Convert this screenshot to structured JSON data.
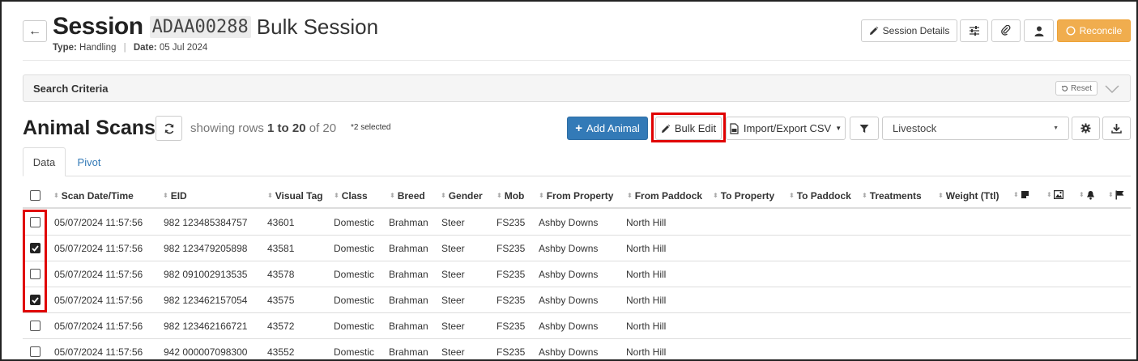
{
  "header": {
    "back_icon": "←",
    "title": "Session",
    "code": "ADAA00288",
    "title_rest": "Bulk Session",
    "type_label": "Type:",
    "type_value": "Handling",
    "date_label": "Date:",
    "date_value": "05 Jul 2024",
    "session_details_label": "Session Details",
    "reconcile_label": "Reconcile"
  },
  "search": {
    "label": "Search Criteria",
    "reset_label": "Reset"
  },
  "scans": {
    "title": "Animal Scans",
    "showing_prefix": "showing rows ",
    "range": "1 to 20",
    "of_text": " of 20",
    "selected_note": "*2 selected",
    "add_label": "Add Animal",
    "bulk_edit_label": "Bulk Edit",
    "csv_label": "Import/Export CSV",
    "livestock_value": "Livestock"
  },
  "tabs": [
    "Data",
    "Pivot"
  ],
  "columns": [
    "Scan Date/Time",
    "EID",
    "Visual Tag",
    "Class",
    "Breed",
    "Gender",
    "Mob",
    "From Property",
    "From Paddock",
    "To Property",
    "To Paddock",
    "Treatments",
    "Weight (Ttl)"
  ],
  "rows": [
    {
      "checked": false,
      "date": "05/07/2024 11:57:56",
      "eid": "982 123485384757",
      "tag": "43601",
      "class": "Domestic",
      "breed": "Brahman",
      "gender": "Steer",
      "mob": "FS235",
      "from_property": "Ashby Downs",
      "from_paddock": "North Hill"
    },
    {
      "checked": true,
      "date": "05/07/2024 11:57:56",
      "eid": "982 123479205898",
      "tag": "43581",
      "class": "Domestic",
      "breed": "Brahman",
      "gender": "Steer",
      "mob": "FS235",
      "from_property": "Ashby Downs",
      "from_paddock": "North Hill"
    },
    {
      "checked": false,
      "date": "05/07/2024 11:57:56",
      "eid": "982 091002913535",
      "tag": "43578",
      "class": "Domestic",
      "breed": "Brahman",
      "gender": "Steer",
      "mob": "FS235",
      "from_property": "Ashby Downs",
      "from_paddock": "North Hill"
    },
    {
      "checked": true,
      "date": "05/07/2024 11:57:56",
      "eid": "982 123462157054",
      "tag": "43575",
      "class": "Domestic",
      "breed": "Brahman",
      "gender": "Steer",
      "mob": "FS235",
      "from_property": "Ashby Downs",
      "from_paddock": "North Hill"
    },
    {
      "checked": false,
      "date": "05/07/2024 11:57:56",
      "eid": "982 123462166721",
      "tag": "43572",
      "class": "Domestic",
      "breed": "Brahman",
      "gender": "Steer",
      "mob": "FS235",
      "from_property": "Ashby Downs",
      "from_paddock": "North Hill"
    },
    {
      "checked": false,
      "date": "05/07/2024 11:57:56",
      "eid": "942 000007098300",
      "tag": "43552",
      "class": "Domestic",
      "breed": "Brahman",
      "gender": "Steer",
      "mob": "FS235",
      "from_property": "Ashby Downs",
      "from_paddock": "North Hill"
    }
  ],
  "colors": {
    "primary": "#337ab7",
    "warning": "#f0ad4e",
    "highlight": "#e00000"
  }
}
